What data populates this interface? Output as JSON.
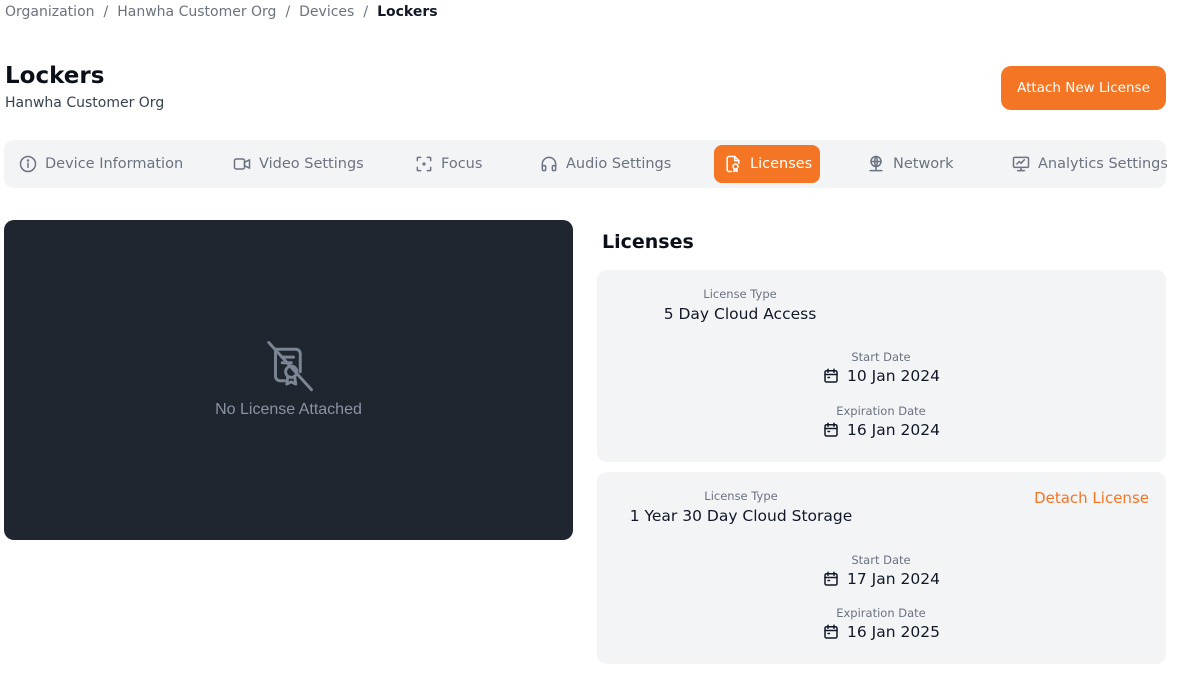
{
  "breadcrumb": [
    {
      "label": "Organization"
    },
    {
      "label": "Hanwha Customer Org"
    },
    {
      "label": "Devices"
    },
    {
      "label": "Lockers"
    }
  ],
  "breadcrumb_separator": "/",
  "header": {
    "title": "Lockers",
    "subtitle": "Hanwha Customer Org",
    "attach_button": "Attach New License"
  },
  "tabs": [
    {
      "label": "Device Information",
      "icon": "info-circle-icon",
      "active": false
    },
    {
      "label": "Video Settings",
      "icon": "video-camera-icon",
      "active": false
    },
    {
      "label": "Focus",
      "icon": "focus-frame-icon",
      "active": false
    },
    {
      "label": "Audio Settings",
      "icon": "headphones-icon",
      "active": false
    },
    {
      "label": "Licenses",
      "icon": "license-document-icon",
      "active": true
    },
    {
      "label": "Network",
      "icon": "network-globe-icon",
      "active": false
    },
    {
      "label": "Analytics Settings",
      "icon": "analytics-monitor-icon",
      "active": false
    }
  ],
  "preview": {
    "message": "No License Attached",
    "icon": "license-off-icon"
  },
  "licenses": {
    "heading": "Licenses",
    "type_label": "License Type",
    "start_label": "Start Date",
    "expiration_label": "Expiration Date",
    "detach_label": "Detach License",
    "items": [
      {
        "type": "5 Day Cloud Access",
        "start": "10 Jan 2024",
        "expiration": "16 Jan 2024",
        "detachable": false
      },
      {
        "type": "1 Year 30 Day Cloud Storage",
        "start": "17 Jan 2024",
        "expiration": "16 Jan 2025",
        "detachable": true
      }
    ]
  },
  "colors": {
    "accent": "#f47524",
    "tab_bar_bg": "#f3f4f6",
    "card_bg": "#f3f4f6",
    "preview_bg": "#20262f"
  }
}
